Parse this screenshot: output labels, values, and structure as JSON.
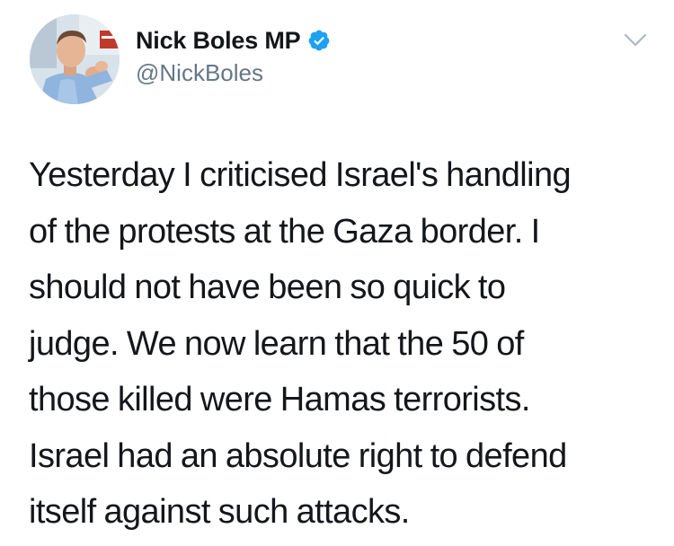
{
  "author": {
    "display_name": "Nick Boles MP",
    "handle": "@NickBoles",
    "verified": true,
    "avatar_icon": "profile-photo",
    "verified_icon": "verified-badge-icon",
    "verified_color": "#1da1f2"
  },
  "menu": {
    "icon": "chevron-down-icon",
    "color": "#aab8c2"
  },
  "tweet": {
    "lines": [
      "Yesterday I criticised Israel's handling",
      "of the protests at the Gaza border. I",
      "should not have been so quick to",
      "judge. We now learn that the 50 of",
      "those killed were Hamas terrorists.",
      "Israel had an absolute right to defend",
      "itself against such attacks."
    ]
  },
  "colors": {
    "text": "#14171a",
    "secondary": "#657786",
    "background": "#ffffff"
  }
}
